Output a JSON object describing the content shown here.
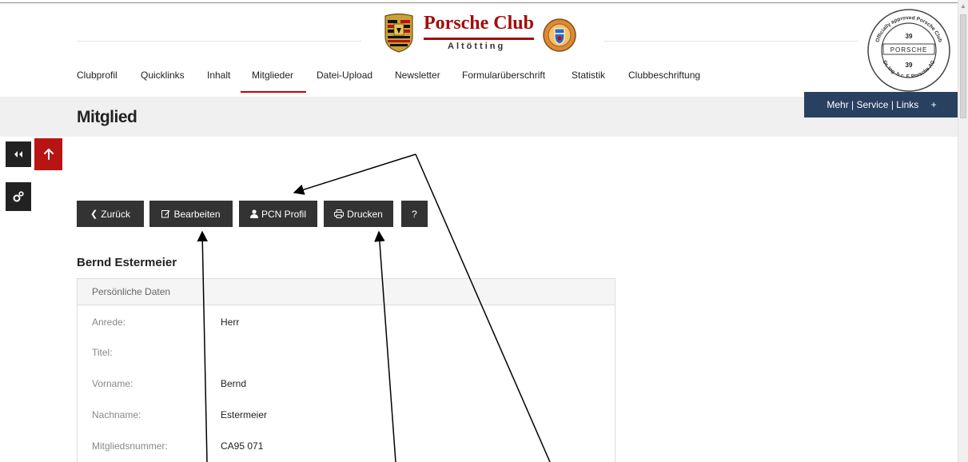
{
  "header": {
    "brand_title": "Porsche Club",
    "brand_subtitle": "Altötting",
    "seal_text_top": "Officially approved Porsche Club",
    "seal_number": "39",
    "seal_wordmark": "PORSCHE",
    "seal_text_bottom": "Dr. Ing. h.c. F. Porsche AG"
  },
  "nav": {
    "items": [
      {
        "label": "Clubprofil"
      },
      {
        "label": "Quicklinks"
      },
      {
        "label": "Inhalt"
      },
      {
        "label": "Mitglieder"
      },
      {
        "label": "Datei-Upload"
      },
      {
        "label": "Newsletter"
      },
      {
        "label": "Formularüberschrift"
      },
      {
        "label": "Statistik"
      },
      {
        "label": "Clubbeschriftung"
      }
    ],
    "active": "Mitglieder"
  },
  "page": {
    "title": "Mitglied",
    "more_label": "Mehr | Service | Links",
    "more_icon": "plus-icon"
  },
  "side_tools": {
    "collapse_icon": "double-chevron-left-icon",
    "top_icon": "arrow-up-icon",
    "settings_icon": "gears-icon"
  },
  "actions": {
    "back": "Zurück",
    "edit": "Bearbeiten",
    "pcn_profile": "PCN Profil",
    "print": "Drucken",
    "help": "?"
  },
  "member": {
    "name": "Bernd Estermeier",
    "section_title": "Persönliche Daten",
    "fields": [
      {
        "label": "Anrede:",
        "value": "Herr"
      },
      {
        "label": "Titel:",
        "value": ""
      },
      {
        "label": "Vorname:",
        "value": "Bernd"
      },
      {
        "label": "Nachname:",
        "value": "Estermeier"
      },
      {
        "label": "Mitgliedsnummer:",
        "value": "CA95 071"
      }
    ]
  },
  "colors": {
    "brand_red": "#a40a0a",
    "nav_active": "#cc0000",
    "button_dark": "#333333",
    "mehr_blue": "#2a4060",
    "band_grey": "#f0f0f0"
  }
}
